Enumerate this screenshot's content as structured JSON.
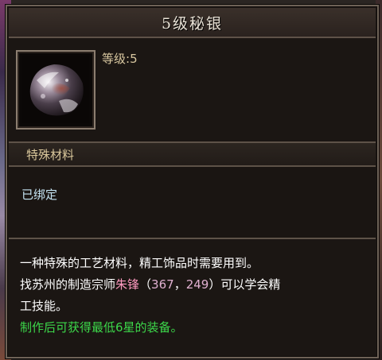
{
  "tooltip": {
    "title": "5级秘银",
    "level_label": "等级",
    "level_sep": ":",
    "level_value": "5",
    "subtype": "特殊材料",
    "bind_status": "已绑定",
    "desc": {
      "line1": "一种特殊的工艺材料，精工饰品时需要用到。",
      "line2_prefix": "找苏州的制造宗师",
      "npc_name": "朱锋",
      "coord_open": "（",
      "coord_x": "367",
      "coord_sep": "，",
      "coord_y": "249",
      "coord_close": "）",
      "line2_suffix": "可以学会精",
      "line3": "工技能。",
      "line4": "制作后可获得最低6星的装备。"
    }
  },
  "icon": "mithril-ore-icon",
  "colors": {
    "title": "#e9e2d6",
    "level": "#d8c7a0",
    "bind": "#c6e4f3",
    "npc": "#ff9ac0",
    "green": "#3cd84a"
  }
}
